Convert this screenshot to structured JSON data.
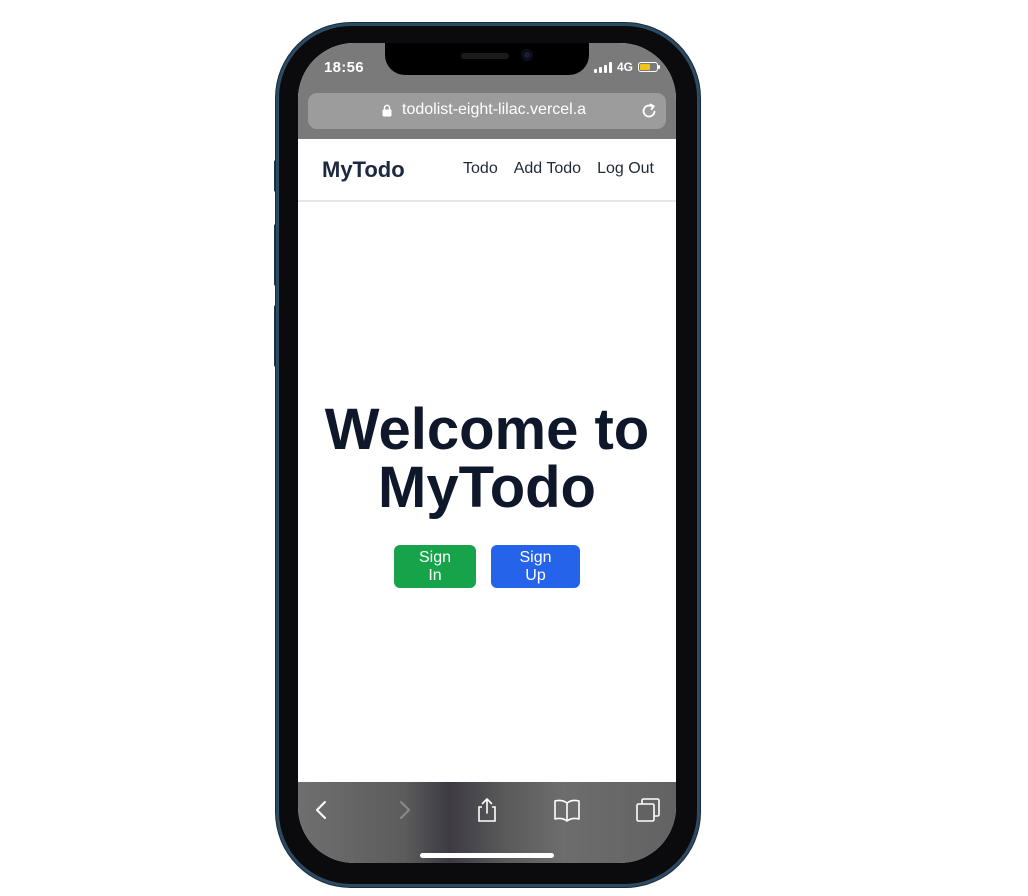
{
  "status_bar": {
    "time": "18:56",
    "network": "4G",
    "battery_color": "#f0c419"
  },
  "browser": {
    "url": "todolist-eight-lilac.vercel.a",
    "icons": [
      "lock-icon",
      "reload-icon",
      "back-icon",
      "forward-icon",
      "share-icon",
      "bookmarks-icon",
      "tabs-icon"
    ]
  },
  "navbar": {
    "brand": "MyTodo",
    "links": [
      "Todo",
      "Add Todo",
      "Log Out"
    ]
  },
  "hero": {
    "title_line1": "Welcome to",
    "title_line2": "MyTodo",
    "signin_label": "Sign In",
    "signup_label": "Sign Up",
    "signin_color": "#16a34a",
    "signup_color": "#2563eb"
  }
}
